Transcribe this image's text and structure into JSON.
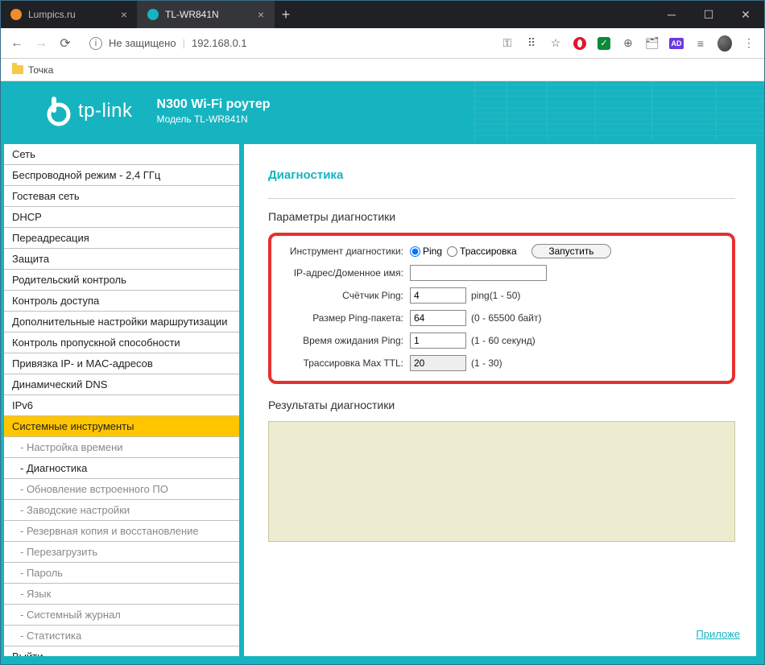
{
  "browser": {
    "tabs": [
      {
        "title": "Lumpics.ru",
        "favicon_color": "#f08c2e"
      },
      {
        "title": "TL-WR841N",
        "favicon_color": "#16b4c0"
      }
    ],
    "address_label": "Не защищено",
    "address_url": "192.168.0.1",
    "bookmark": "Точка"
  },
  "banner": {
    "logo_text": "tp-link",
    "title": "N300 Wi-Fi роутер",
    "subtitle": "Модель TL-WR841N"
  },
  "sidebar": [
    {
      "label": "Сеть",
      "type": "item"
    },
    {
      "label": "Беспроводной режим - 2,4 ГГц",
      "type": "item"
    },
    {
      "label": "Гостевая сеть",
      "type": "item"
    },
    {
      "label": "DHCP",
      "type": "item"
    },
    {
      "label": "Переадресация",
      "type": "item"
    },
    {
      "label": "Защита",
      "type": "item"
    },
    {
      "label": "Родительский контроль",
      "type": "item"
    },
    {
      "label": "Контроль доступа",
      "type": "item"
    },
    {
      "label": "Дополнительные настройки маршрутизации",
      "type": "item"
    },
    {
      "label": "Контроль пропускной способности",
      "type": "item"
    },
    {
      "label": "Привязка IP- и MAC-адресов",
      "type": "item"
    },
    {
      "label": "Динамический DNS",
      "type": "item"
    },
    {
      "label": "IPv6",
      "type": "item"
    },
    {
      "label": "Системные инструменты",
      "type": "active"
    },
    {
      "label": "- Настройка времени",
      "type": "sub"
    },
    {
      "label": "- Диагностика",
      "type": "sub-current"
    },
    {
      "label": "- Обновление встроенного ПО",
      "type": "sub"
    },
    {
      "label": "- Заводские настройки",
      "type": "sub"
    },
    {
      "label": "- Резервная копия и восстановление",
      "type": "sub"
    },
    {
      "label": "- Перезагрузить",
      "type": "sub"
    },
    {
      "label": "- Пароль",
      "type": "sub"
    },
    {
      "label": "- Язык",
      "type": "sub"
    },
    {
      "label": "- Системный журнал",
      "type": "sub"
    },
    {
      "label": "- Статистика",
      "type": "sub"
    },
    {
      "label": "Выйти",
      "type": "item"
    }
  ],
  "content": {
    "page_title": "Диагностика",
    "params_title": "Параметры диагностики",
    "labels": {
      "tool": "Инструмент диагностики:",
      "ip": "IP-адрес/Доменное имя:",
      "count": "Счётчик Ping:",
      "size": "Размер Ping-пакета:",
      "timeout": "Время ожидания Ping:",
      "ttl": "Трассировка Max TTL:"
    },
    "radios": {
      "ping": "Ping",
      "trace": "Трассировка"
    },
    "run": "Запустить",
    "values": {
      "ip": "",
      "count": "4",
      "size": "64",
      "timeout": "1",
      "ttl": "20"
    },
    "hints": {
      "count": "ping(1 - 50)",
      "size": "(0 - 65500 байт)",
      "timeout": "(1 - 60 секунд)",
      "ttl": "(1 - 30)"
    },
    "results_title": "Результаты диагностики",
    "help_link": "Приложе"
  }
}
